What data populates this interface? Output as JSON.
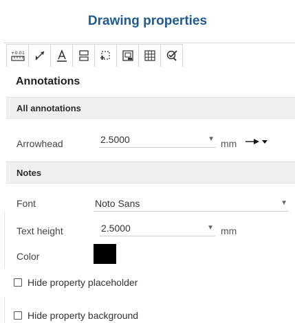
{
  "title": "Drawing properties",
  "toolbar": {
    "tabs": [
      {
        "name": "tolerance-tab",
        "icon": "tolerance-icon",
        "text": "+0.01"
      },
      {
        "name": "dimension-tab",
        "icon": "dimension-arrow-icon"
      },
      {
        "name": "annotations-tab",
        "icon": "text-annotation-icon",
        "active": true
      },
      {
        "name": "table-format-tab",
        "icon": "table-format-icon"
      },
      {
        "name": "view-region-tab",
        "icon": "view-region-icon"
      },
      {
        "name": "sheet-frame-tab",
        "icon": "sheet-frame-icon"
      },
      {
        "name": "grid-tab",
        "icon": "grid-icon"
      },
      {
        "name": "check-tab",
        "icon": "check-tool-icon"
      }
    ]
  },
  "panel": {
    "heading": "Annotations",
    "all_annotations": {
      "header": "All annotations",
      "arrowhead": {
        "label": "Arrowhead",
        "value": "2.5000",
        "unit": "mm"
      }
    },
    "notes": {
      "header": "Notes",
      "font": {
        "label": "Font",
        "value": "Noto Sans"
      },
      "text_height": {
        "label": "Text height",
        "value": "2.5000",
        "unit": "mm"
      },
      "color": {
        "label": "Color",
        "value": "#000000"
      }
    },
    "options": {
      "hide_placeholder": {
        "label": "Hide property placeholder",
        "checked": false
      },
      "hide_background": {
        "label": "Hide property background",
        "checked": false
      }
    }
  },
  "colors": {
    "title": "#1f5a93",
    "section_bg": "#f0f0f0",
    "border": "#d6d6d6"
  }
}
